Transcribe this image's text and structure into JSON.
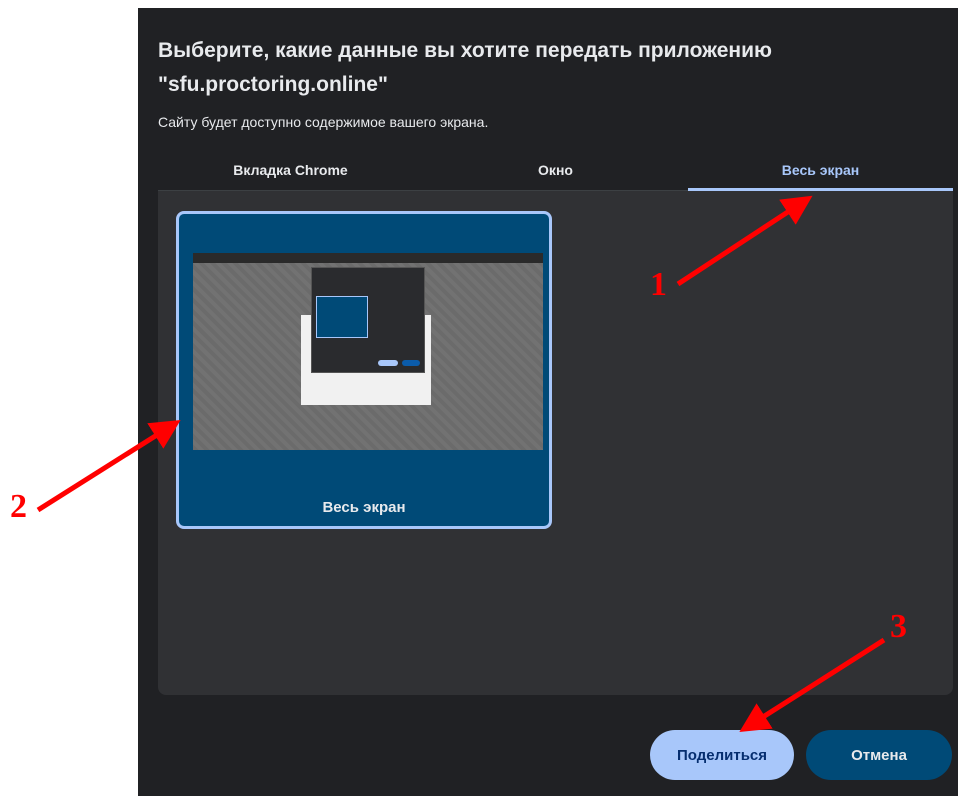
{
  "dialog": {
    "title": "Выберите, какие данные вы хотите передать приложению \"sfu.proctoring.online\"",
    "subtitle": "Сайту будет доступно содержимое вашего экрана."
  },
  "tabs": [
    {
      "label": "Вкладка Chrome",
      "active": false
    },
    {
      "label": "Окно",
      "active": false
    },
    {
      "label": "Весь экран",
      "active": true
    }
  ],
  "screen_tile": {
    "label": "Весь экран",
    "selected": true
  },
  "buttons": {
    "share": "Поделиться",
    "cancel": "Отмена"
  },
  "annotations": {
    "marker_1": "1",
    "marker_2": "2",
    "marker_3": "3"
  },
  "colors": {
    "dialog_bg": "#202124",
    "panel_bg": "#303134",
    "accent": "#a8c7fa",
    "tile_bg": "#004a77",
    "annotation": "#ff0000"
  }
}
